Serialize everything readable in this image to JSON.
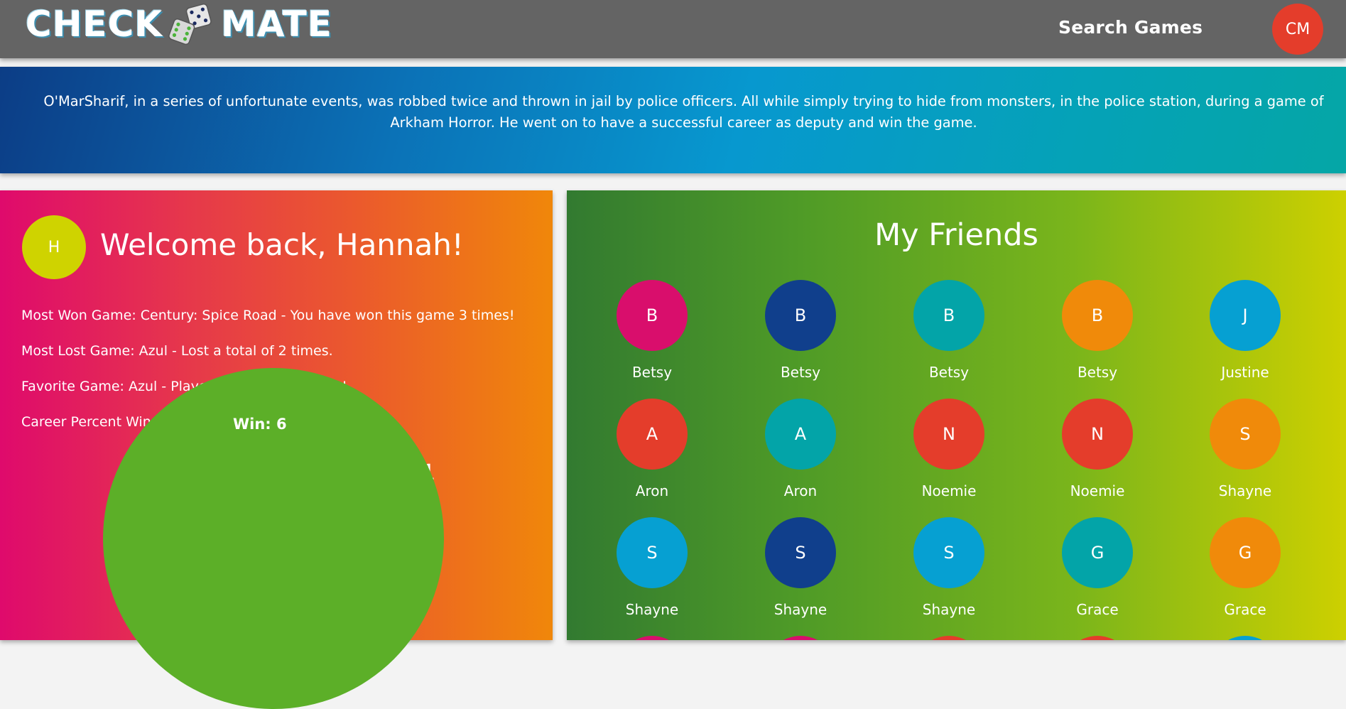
{
  "header": {
    "logo_left": "CHECK",
    "logo_right": "MATE",
    "search_label": "Search Games",
    "user_initials": "CM"
  },
  "banner": {
    "text": "O'MarSharif, in a series of unfortunate events, was robbed twice and thrown in jail by police officers. All while simply trying to hide from monsters, in the police station, during a game of Arkham Horror. He went on to have a successful career as deputy and win the game."
  },
  "profile": {
    "initial": "H",
    "welcome": "Welcome back, Hannah!",
    "stats": [
      "Most Won Game: Century: Spice Road - You have won this game 3 times!",
      "Most Lost Game: Azul - Lost a total of 2 times.",
      "Favorite Game: Azul - Played this game 7 times!",
      "Career Percent Wins: 54%"
    ],
    "career_title": "Career Stats - Total Games 11",
    "pie_label": "Win: 6"
  },
  "friends": {
    "title": "My Friends",
    "items": [
      {
        "initial": "B",
        "name": "Betsy",
        "color": "#d90e6c"
      },
      {
        "initial": "B",
        "name": "Betsy",
        "color": "#103f8c"
      },
      {
        "initial": "B",
        "name": "Betsy",
        "color": "#03a4a8"
      },
      {
        "initial": "B",
        "name": "Betsy",
        "color": "#f08a0a"
      },
      {
        "initial": "J",
        "name": "Justine",
        "color": "#06a0d2"
      },
      {
        "initial": "A",
        "name": "Aron",
        "color": "#e43d2b"
      },
      {
        "initial": "A",
        "name": "Aron",
        "color": "#03a4a8"
      },
      {
        "initial": "N",
        "name": "Noemie",
        "color": "#e43d2b"
      },
      {
        "initial": "N",
        "name": "Noemie",
        "color": "#e43d2b"
      },
      {
        "initial": "S",
        "name": "Shayne",
        "color": "#f08a0a"
      },
      {
        "initial": "S",
        "name": "Shayne",
        "color": "#06a0d2"
      },
      {
        "initial": "S",
        "name": "Shayne",
        "color": "#103f8c"
      },
      {
        "initial": "S",
        "name": "Shayne",
        "color": "#06a0d2"
      },
      {
        "initial": "G",
        "name": "Grace",
        "color": "#03a4a8"
      },
      {
        "initial": "G",
        "name": "Grace",
        "color": "#f08a0a"
      }
    ],
    "partial_row_colors": [
      "#d90e6c",
      "#d90e6c",
      "#e43d2b",
      "#e43d2b",
      "#06a0d2"
    ]
  }
}
